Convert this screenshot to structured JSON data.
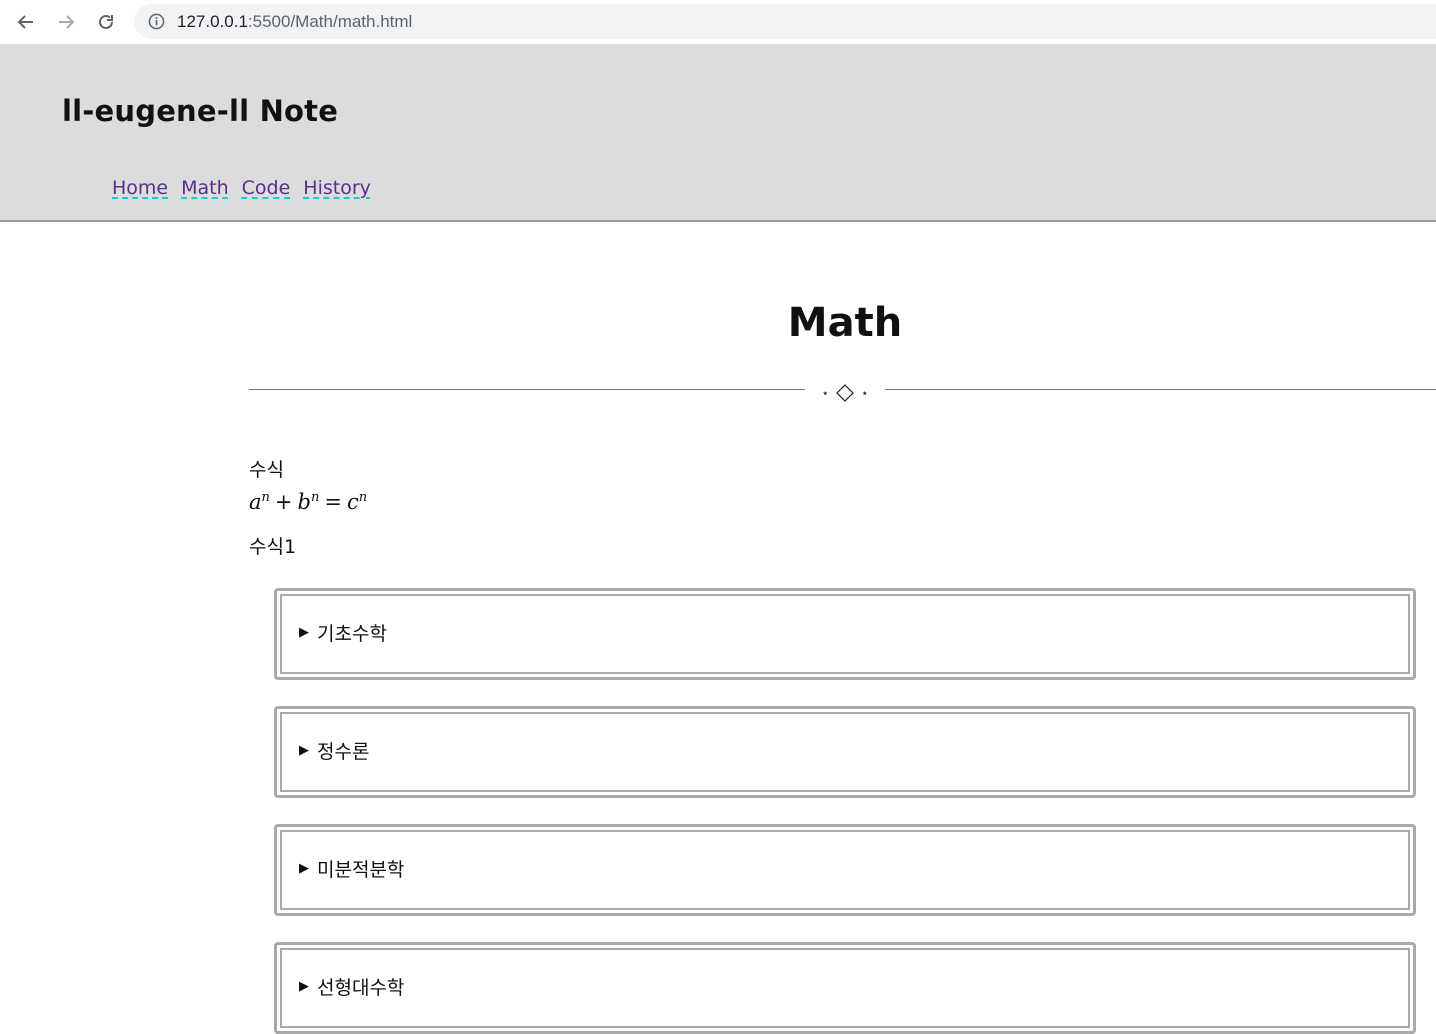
{
  "browser": {
    "url_host": "127.0.0.1",
    "url_rest": ":5500/Math/math.html",
    "back_icon": "arrow-left-icon",
    "forward_icon": "arrow-right-icon",
    "reload_icon": "reload-icon",
    "info_icon": "info-icon"
  },
  "header": {
    "brand": "ll-eugene-ll Note",
    "nav": [
      {
        "label": "Home"
      },
      {
        "label": "Math"
      },
      {
        "label": "Code"
      },
      {
        "label": "History"
      }
    ],
    "link_color": "#5b2d91",
    "underline_color": "#19c7d6",
    "background": "#dcdcdc"
  },
  "main": {
    "title": "Math",
    "ornament": {
      "left": "⋆",
      "center_icon": "diamond-icon",
      "right": "⋆"
    },
    "formula_label": "수식",
    "equation": {
      "a": "a",
      "b": "b",
      "c": "c",
      "exp": "n",
      "plus": "+",
      "equals": "="
    },
    "formula_label_2": "수식1",
    "sections": [
      {
        "label": "기초수학"
      },
      {
        "label": "정수론"
      },
      {
        "label": "미분적분학"
      },
      {
        "label": "선형대수학"
      }
    ],
    "toggle_glyph": "▶"
  }
}
